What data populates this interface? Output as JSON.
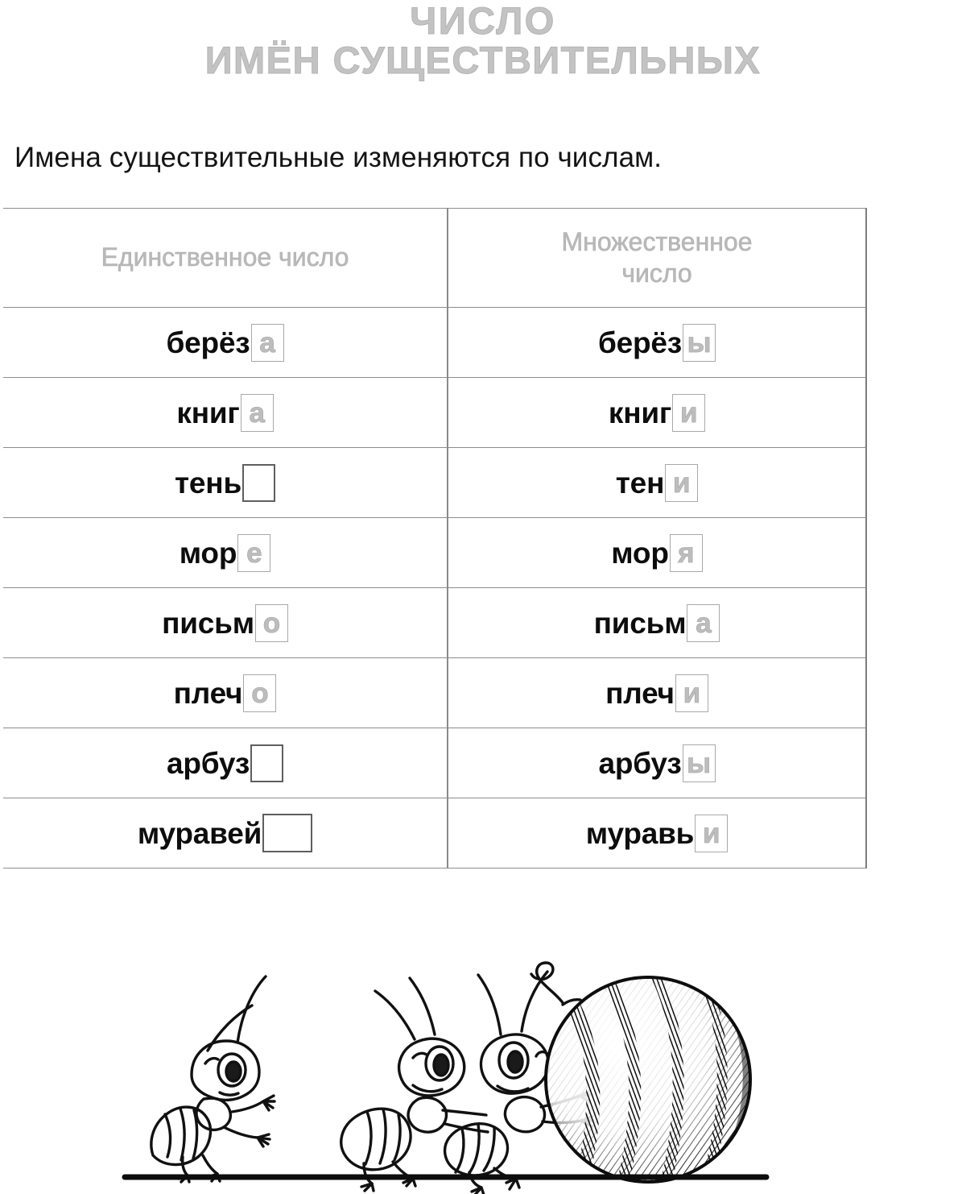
{
  "title": {
    "line1": "ЧИСЛО",
    "line2": "ИМЁН СУЩЕСТВИТЕЛЬНЫХ"
  },
  "intro": "Имена существительные изменяются по числам.",
  "table": {
    "headers": {
      "singular": "Единственное число",
      "plural_line1": "Множественное",
      "plural_line2": "число"
    },
    "rows": [
      {
        "singular": {
          "stem": "берёз",
          "ending": "а",
          "empty": false,
          "wide": false
        },
        "plural": {
          "stem": "берёз",
          "ending": "ы",
          "empty": false,
          "wide": false
        }
      },
      {
        "singular": {
          "stem": "книг",
          "ending": "а",
          "empty": false,
          "wide": false
        },
        "plural": {
          "stem": "книг",
          "ending": "и",
          "empty": false,
          "wide": false
        }
      },
      {
        "singular": {
          "stem": "тень",
          "ending": "",
          "empty": true,
          "wide": false
        },
        "plural": {
          "stem": "тен",
          "ending": "и",
          "empty": false,
          "wide": false
        }
      },
      {
        "singular": {
          "stem": "мор",
          "ending": "е",
          "empty": false,
          "wide": false
        },
        "plural": {
          "stem": "мор",
          "ending": "я",
          "empty": false,
          "wide": false
        }
      },
      {
        "singular": {
          "stem": "письм",
          "ending": "о",
          "empty": false,
          "wide": false
        },
        "plural": {
          "stem": "письм",
          "ending": "а",
          "empty": false,
          "wide": false
        }
      },
      {
        "singular": {
          "stem": "плеч",
          "ending": "о",
          "empty": false,
          "wide": false
        },
        "plural": {
          "stem": "плеч",
          "ending": "и",
          "empty": false,
          "wide": false
        }
      },
      {
        "singular": {
          "stem": "арбуз",
          "ending": "",
          "empty": true,
          "wide": false
        },
        "plural": {
          "stem": "арбуз",
          "ending": "ы",
          "empty": false,
          "wide": false
        }
      },
      {
        "singular": {
          "stem": "муравей",
          "ending": "",
          "empty": true,
          "wide": true
        },
        "plural": {
          "stem": "муравь",
          "ending": "и",
          "empty": false,
          "wide": false
        }
      }
    ]
  },
  "illustration": {
    "description": "Три муравья катят большой полосатый арбуз по земле",
    "items": [
      "ant-watching",
      "ant-pushing-left",
      "ant-pushing-right",
      "watermelon",
      "ground-line"
    ]
  },
  "colors": {
    "title_gray": "#c3c3c3",
    "header_gray": "#b9b9b9",
    "ending_gray": "#bdbdbd",
    "text_black": "#0d0d0d",
    "table_line": "#8d8d8d",
    "empty_box_border": "#5f5f5f"
  }
}
